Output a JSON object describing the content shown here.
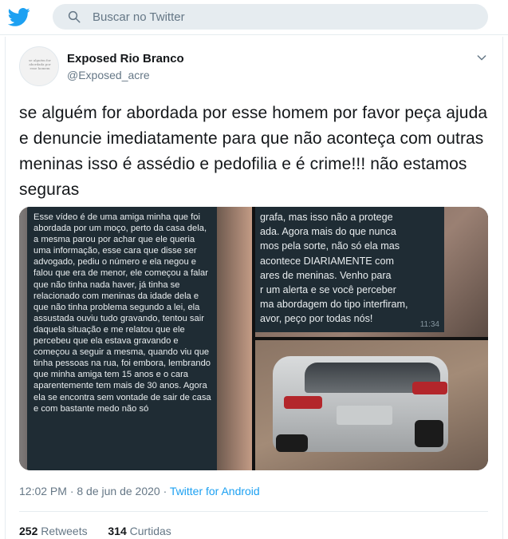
{
  "topbar": {
    "logo_icon": "twitter-bird-icon",
    "brand_color": "#1DA1F2",
    "search_placeholder": "Buscar no Twitter",
    "search_icon": "search-icon"
  },
  "tweet": {
    "display_name": "Exposed Rio Branco",
    "handle": "@Exposed_acre",
    "avatar_text": "se alguém for abordada por esse homem",
    "menu_icon": "chevron-down-icon",
    "text": "se alguém for abordada por esse homem por favor peça ajuda e denuncie imediatamente para que não aconteça com outras meninas isso é assédio e pedofilia e é crime!!! não estamos seguras",
    "media": {
      "chat_left": "Esse vídeo é de uma amiga minha que foi abordada por um moço, perto da casa dela, a mesma parou por achar que ele queria uma informação, esse cara que disse ser advogado, pediu o número e ela negou e falou que era de menor, ele começou a falar que não tinha nada haver, já tinha se relacionado com meninas da idade dela e que não tinha problema segundo a lei, ela assustada ouviu tudo gravando, tentou sair daquela situação e me relatou que ele percebeu que ela estava gravando e começou a seguir a mesma, quando viu que tinha pessoas na rua, foi embora, lembrando que minha amiga tem 15 anos e o cara aparentemente tem mais de 30 anos. Agora ela se encontra sem vontade de sair de casa e com bastante medo não só",
      "chat_right": "grafa, mas isso não a protege\nada. Agora mais do que nunca\nmos pela sorte, não só ela mas\nacontece DIARIAMENTE com\nares de meninas. Venho para\nr um alerta e se você perceber\nma abordagem do tipo interfiram,\navor, peço por todas nós!",
      "chat_time": "11:34"
    },
    "timestamp": "12:02 PM · 8 de jun de 2020 ·",
    "source": "Twitter for Android",
    "retweets_count": "252",
    "retweets_label": "Retweets",
    "likes_count": "314",
    "likes_label": "Curtidas"
  }
}
